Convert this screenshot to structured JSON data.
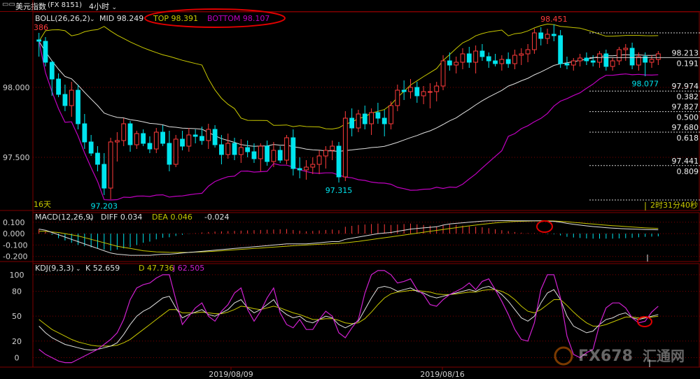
{
  "header": {
    "symbol": "美元指数",
    "code": "(FX 8151)",
    "period": "4小时",
    "toolbar_glyph": "▭▭"
  },
  "colors": {
    "up": "#ff3b3b",
    "down": "#00e5ee",
    "mid": "#e0e0e0",
    "top": "#c8c800",
    "bottom": "#c000c0",
    "grid": "#800000",
    "axis_text": "#d0d0d0",
    "diff": "#e0e0e0",
    "dea": "#c8c800",
    "k": "#e0e0e0",
    "d": "#c8c800",
    "j": "#d020d0",
    "annotation": "#e00000",
    "watermark": "#bbbbbb"
  },
  "chart_data": [
    {
      "type": "candlestick",
      "panel": "price",
      "indicator_label": "BOLL(26,26,2)",
      "readouts": [
        {
          "name": "MID",
          "value": "98.249"
        },
        {
          "name": "TOP",
          "value": "98.391"
        },
        {
          "name": "BOTTOM",
          "value": "98.107"
        }
      ],
      "y_ticks": [
        "98.000",
        "97.500"
      ],
      "ylim": [
        97.15,
        98.45
      ],
      "candles": [
        [
          98.34,
          98.39,
          98.22,
          98.33
        ],
        [
          98.33,
          98.36,
          98.15,
          98.18
        ],
        [
          98.18,
          98.19,
          97.94,
          98.06
        ],
        [
          98.06,
          98.1,
          97.93,
          97.95
        ],
        [
          97.95,
          98.02,
          97.83,
          97.87
        ],
        [
          97.87,
          98.04,
          97.79,
          97.98
        ],
        [
          97.98,
          98.02,
          97.7,
          97.74
        ],
        [
          97.74,
          97.81,
          97.56,
          97.61
        ],
        [
          97.61,
          97.66,
          97.51,
          97.53
        ],
        [
          97.53,
          97.58,
          97.4,
          97.45
        ],
        [
          97.45,
          97.53,
          97.23,
          97.28
        ],
        [
          97.28,
          97.64,
          97.2,
          97.61
        ],
        [
          97.61,
          97.68,
          97.47,
          97.62
        ],
        [
          97.62,
          97.78,
          97.58,
          97.74
        ],
        [
          97.74,
          97.76,
          97.54,
          97.59
        ],
        [
          97.59,
          97.69,
          97.56,
          97.67
        ],
        [
          97.67,
          97.7,
          97.58,
          97.6
        ],
        [
          97.6,
          97.65,
          97.53,
          97.56
        ],
        [
          97.56,
          97.71,
          97.53,
          97.68
        ],
        [
          97.68,
          97.73,
          97.58,
          97.6
        ],
        [
          97.6,
          97.69,
          97.4,
          97.45
        ],
        [
          97.45,
          97.66,
          97.43,
          97.63
        ],
        [
          97.63,
          97.69,
          97.55,
          97.58
        ],
        [
          97.58,
          97.71,
          97.54,
          97.66
        ],
        [
          97.66,
          97.7,
          97.6,
          97.65
        ],
        [
          97.65,
          97.72,
          97.59,
          97.62
        ],
        [
          97.62,
          97.74,
          97.56,
          97.7
        ],
        [
          97.7,
          97.73,
          97.57,
          97.59
        ],
        [
          97.59,
          97.66,
          97.45,
          97.52
        ],
        [
          97.52,
          97.67,
          97.49,
          97.6
        ],
        [
          97.6,
          97.64,
          97.48,
          97.52
        ],
        [
          97.52,
          97.63,
          97.46,
          97.57
        ],
        [
          97.57,
          97.62,
          97.5,
          97.54
        ],
        [
          97.54,
          97.6,
          97.46,
          97.49
        ],
        [
          97.49,
          97.6,
          97.4,
          97.58
        ],
        [
          97.58,
          97.62,
          97.44,
          97.47
        ],
        [
          97.47,
          97.61,
          97.43,
          97.55
        ],
        [
          97.55,
          97.58,
          97.46,
          97.48
        ],
        [
          97.48,
          97.66,
          97.45,
          97.64
        ],
        [
          97.64,
          97.7,
          97.37,
          97.42
        ],
        [
          97.42,
          97.5,
          97.35,
          97.41
        ],
        [
          97.41,
          97.48,
          97.34,
          97.43
        ],
        [
          97.43,
          97.5,
          97.38,
          97.45
        ],
        [
          97.45,
          97.55,
          97.38,
          97.51
        ],
        [
          97.51,
          97.58,
          97.42,
          97.55
        ],
        [
          97.55,
          97.62,
          97.48,
          97.58
        ],
        [
          97.58,
          97.61,
          97.32,
          97.36
        ],
        [
          97.36,
          97.83,
          97.33,
          97.78
        ],
        [
          97.78,
          97.85,
          97.65,
          97.71
        ],
        [
          97.71,
          97.84,
          97.68,
          97.81
        ],
        [
          97.81,
          97.87,
          97.7,
          97.74
        ],
        [
          97.74,
          97.85,
          97.66,
          97.82
        ],
        [
          97.82,
          97.89,
          97.74,
          97.78
        ],
        [
          97.78,
          97.84,
          97.65,
          97.74
        ],
        [
          97.74,
          97.9,
          97.7,
          97.87
        ],
        [
          97.87,
          98.02,
          97.83,
          97.98
        ],
        [
          97.98,
          98.05,
          97.91,
          97.97
        ],
        [
          97.97,
          98.06,
          97.92,
          98.0
        ],
        [
          98.0,
          98.04,
          97.89,
          97.94
        ],
        [
          97.94,
          98.01,
          97.88,
          97.97
        ],
        [
          97.97,
          98.03,
          97.85,
          97.97
        ],
        [
          97.97,
          98.04,
          97.9,
          98.01
        ],
        [
          98.01,
          98.23,
          97.98,
          98.19
        ],
        [
          98.19,
          98.25,
          98.12,
          98.16
        ],
        [
          98.16,
          98.22,
          98.1,
          98.18
        ],
        [
          98.18,
          98.28,
          98.13,
          98.24
        ],
        [
          98.24,
          98.29,
          98.14,
          98.18
        ],
        [
          98.18,
          98.3,
          98.1,
          98.26
        ],
        [
          98.26,
          98.31,
          98.19,
          98.22
        ],
        [
          98.22,
          98.25,
          98.14,
          98.19
        ],
        [
          98.19,
          98.24,
          98.15,
          98.17
        ],
        [
          98.17,
          98.23,
          98.12,
          98.2
        ],
        [
          98.2,
          98.25,
          98.14,
          98.17
        ],
        [
          98.17,
          98.27,
          98.13,
          98.23
        ],
        [
          98.23,
          98.28,
          98.16,
          98.24
        ],
        [
          98.24,
          98.31,
          98.18,
          98.27
        ],
        [
          98.27,
          98.42,
          98.24,
          98.39
        ],
        [
          98.39,
          98.43,
          98.3,
          98.35
        ],
        [
          98.35,
          98.42,
          98.31,
          98.38
        ],
        [
          98.38,
          98.45,
          98.33,
          98.37
        ],
        [
          98.37,
          98.41,
          98.14,
          98.17
        ],
        [
          98.17,
          98.22,
          98.13,
          98.16
        ],
        [
          98.16,
          98.21,
          98.12,
          98.19
        ],
        [
          98.19,
          98.24,
          98.15,
          98.21
        ],
        [
          98.21,
          98.25,
          98.16,
          98.19
        ],
        [
          98.19,
          98.23,
          98.15,
          98.18
        ],
        [
          98.18,
          98.26,
          98.14,
          98.24
        ],
        [
          98.24,
          98.27,
          98.12,
          98.15
        ],
        [
          98.15,
          98.21,
          98.12,
          98.19
        ],
        [
          98.19,
          98.29,
          98.16,
          98.27
        ],
        [
          98.27,
          98.31,
          98.19,
          98.28
        ],
        [
          98.28,
          98.32,
          98.13,
          98.16
        ],
        [
          98.16,
          98.25,
          98.12,
          98.22
        ],
        [
          98.22,
          98.25,
          98.08,
          98.18
        ],
        [
          98.18,
          98.23,
          98.14,
          98.2
        ],
        [
          98.2,
          98.26,
          98.16,
          98.24
        ]
      ],
      "annotations": [
        {
          "text": "386",
          "at": 0,
          "price": 98.39
        },
        {
          "text": "97.203",
          "at": 10,
          "price": 97.203
        },
        {
          "text": "97.315",
          "at": 46,
          "price": 97.315
        },
        {
          "text": "98.451",
          "at": 79,
          "price": 98.451
        },
        {
          "text": "98.077",
          "at": 93,
          "price": 98.077
        }
      ],
      "fib_levels": [
        {
          "price": "98.213",
          "ratio": "0.191"
        },
        {
          "price": "97.974",
          "ratio": "0.382"
        },
        {
          "price": "97.827",
          "ratio": "0.500"
        },
        {
          "price": "97.680",
          "ratio": "0.618"
        },
        {
          "price": "97.441",
          "ratio": "0.809"
        }
      ],
      "corner_left": "16天",
      "countdown": "2时31分40秒"
    },
    {
      "type": "line",
      "panel": "macd",
      "indicator_label": "MACD(12,26,9)",
      "readouts": [
        {
          "name": "DIFF",
          "value": "0.034"
        },
        {
          "name": "DEA",
          "value": "0.046"
        },
        {
          "name": "",
          "value": "-0.024"
        }
      ],
      "y_ticks": [
        "0.100",
        "0.000",
        "-0.100",
        "-0.200"
      ],
      "ylim": [
        -0.22,
        0.16
      ],
      "diff": [
        0.04,
        0.03,
        0.01,
        -0.01,
        -0.03,
        -0.05,
        -0.07,
        -0.09,
        -0.11,
        -0.13,
        -0.15,
        -0.17,
        -0.18,
        -0.185,
        -0.19,
        -0.19,
        -0.19,
        -0.19,
        -0.185,
        -0.18,
        -0.18,
        -0.175,
        -0.17,
        -0.165,
        -0.16,
        -0.155,
        -0.15,
        -0.145,
        -0.14,
        -0.135,
        -0.13,
        -0.125,
        -0.12,
        -0.115,
        -0.11,
        -0.105,
        -0.1,
        -0.095,
        -0.09,
        -0.09,
        -0.09,
        -0.09,
        -0.085,
        -0.08,
        -0.075,
        -0.07,
        -0.07,
        -0.05,
        -0.04,
        -0.03,
        -0.02,
        -0.01,
        0.0,
        0.005,
        0.01,
        0.02,
        0.03,
        0.04,
        0.045,
        0.05,
        0.055,
        0.06,
        0.075,
        0.085,
        0.09,
        0.095,
        0.1,
        0.105,
        0.11,
        0.112,
        0.113,
        0.114,
        0.114,
        0.113,
        0.112,
        0.112,
        0.113,
        0.112,
        0.11,
        0.108,
        0.1,
        0.09,
        0.082,
        0.075,
        0.068,
        0.062,
        0.057,
        0.052,
        0.048,
        0.045,
        0.042,
        0.04,
        0.038,
        0.036,
        0.035,
        0.034
      ],
      "dea": [
        0.02,
        0.02,
        0.015,
        0.01,
        0.0,
        -0.01,
        -0.02,
        -0.035,
        -0.05,
        -0.065,
        -0.08,
        -0.095,
        -0.11,
        -0.12,
        -0.13,
        -0.14,
        -0.15,
        -0.155,
        -0.16,
        -0.162,
        -0.164,
        -0.165,
        -0.165,
        -0.164,
        -0.162,
        -0.16,
        -0.157,
        -0.154,
        -0.15,
        -0.146,
        -0.142,
        -0.138,
        -0.134,
        -0.13,
        -0.126,
        -0.122,
        -0.118,
        -0.114,
        -0.11,
        -0.106,
        -0.103,
        -0.1,
        -0.097,
        -0.094,
        -0.091,
        -0.088,
        -0.085,
        -0.08,
        -0.074,
        -0.068,
        -0.06,
        -0.052,
        -0.044,
        -0.036,
        -0.028,
        -0.02,
        -0.012,
        -0.004,
        0.004,
        0.012,
        0.02,
        0.028,
        0.036,
        0.044,
        0.052,
        0.06,
        0.068,
        0.075,
        0.082,
        0.088,
        0.094,
        0.099,
        0.103,
        0.106,
        0.108,
        0.11,
        0.111,
        0.112,
        0.112,
        0.111,
        0.108,
        0.104,
        0.099,
        0.094,
        0.089,
        0.084,
        0.079,
        0.074,
        0.07,
        0.066,
        0.062,
        0.058,
        0.054,
        0.05,
        0.048,
        0.046
      ]
    },
    {
      "type": "line",
      "panel": "kdj",
      "indicator_label": "KDJ(9,3,3)",
      "readouts": [
        {
          "name": "K",
          "value": "52.659"
        },
        {
          "name": "D",
          "value": "47.736"
        },
        {
          "name": "J",
          "value": "62.505"
        }
      ],
      "y_ticks": [
        "100",
        "80",
        "50",
        "20",
        "0"
      ],
      "ylim": [
        -8,
        110
      ],
      "k": [
        38,
        30,
        24,
        20,
        16,
        14,
        12,
        10,
        9,
        10,
        12,
        14,
        18,
        28,
        40,
        50,
        56,
        60,
        66,
        72,
        74,
        60,
        48,
        52,
        55,
        58,
        52,
        50,
        54,
        58,
        66,
        70,
        60,
        54,
        58,
        64,
        70,
        58,
        52,
        48,
        50,
        44,
        42,
        46,
        50,
        48,
        40,
        36,
        40,
        44,
        58,
        72,
        84,
        86,
        84,
        80,
        82,
        84,
        80,
        78,
        74,
        72,
        74,
        76,
        78,
        80,
        82,
        80,
        84,
        86,
        82,
        76,
        68,
        58,
        48,
        44,
        50,
        66,
        78,
        82,
        70,
        50,
        38,
        34,
        30,
        32,
        40,
        46,
        48,
        52,
        54,
        48,
        46,
        48,
        50,
        52
      ],
      "d": [
        46,
        40,
        34,
        30,
        26,
        22,
        19,
        17,
        15,
        14,
        14,
        14,
        15,
        18,
        22,
        28,
        34,
        40,
        46,
        52,
        58,
        58,
        54,
        54,
        54,
        55,
        54,
        53,
        53,
        55,
        58,
        62,
        61,
        59,
        58,
        60,
        62,
        60,
        57,
        54,
        52,
        49,
        46,
        46,
        47,
        47,
        45,
        42,
        41,
        42,
        47,
        55,
        64,
        72,
        77,
        79,
        80,
        81,
        81,
        80,
        79,
        77,
        76,
        76,
        77,
        78,
        79,
        79,
        81,
        82,
        82,
        80,
        76,
        70,
        62,
        56,
        54,
        58,
        64,
        70,
        70,
        63,
        55,
        48,
        42,
        38,
        38,
        40,
        43,
        46,
        49,
        49,
        48,
        48,
        49,
        50
      ],
      "j": [
        10,
        4,
        0,
        -4,
        -6,
        -6,
        -2,
        2,
        6,
        10,
        16,
        22,
        30,
        46,
        70,
        84,
        88,
        90,
        96,
        100,
        100,
        70,
        40,
        50,
        60,
        66,
        50,
        44,
        56,
        64,
        78,
        84,
        58,
        44,
        56,
        72,
        84,
        54,
        40,
        36,
        46,
        34,
        34,
        46,
        56,
        50,
        30,
        24,
        36,
        46,
        78,
        100,
        105,
        105,
        100,
        90,
        92,
        95,
        82,
        76,
        64,
        62,
        70,
        76,
        80,
        84,
        90,
        82,
        92,
        95,
        82,
        68,
        52,
        34,
        22,
        20,
        42,
        82,
        100,
        100,
        72,
        26,
        4,
        0,
        6,
        10,
        40,
        60,
        66,
        66,
        60,
        48,
        42,
        44,
        55,
        62
      ]
    },
    {
      "panel": "time_axis",
      "x_labels": [
        "2019/08/09",
        "2019/08/16"
      ]
    }
  ],
  "watermark": {
    "brand": "FX678",
    "cn": "汇通网"
  }
}
